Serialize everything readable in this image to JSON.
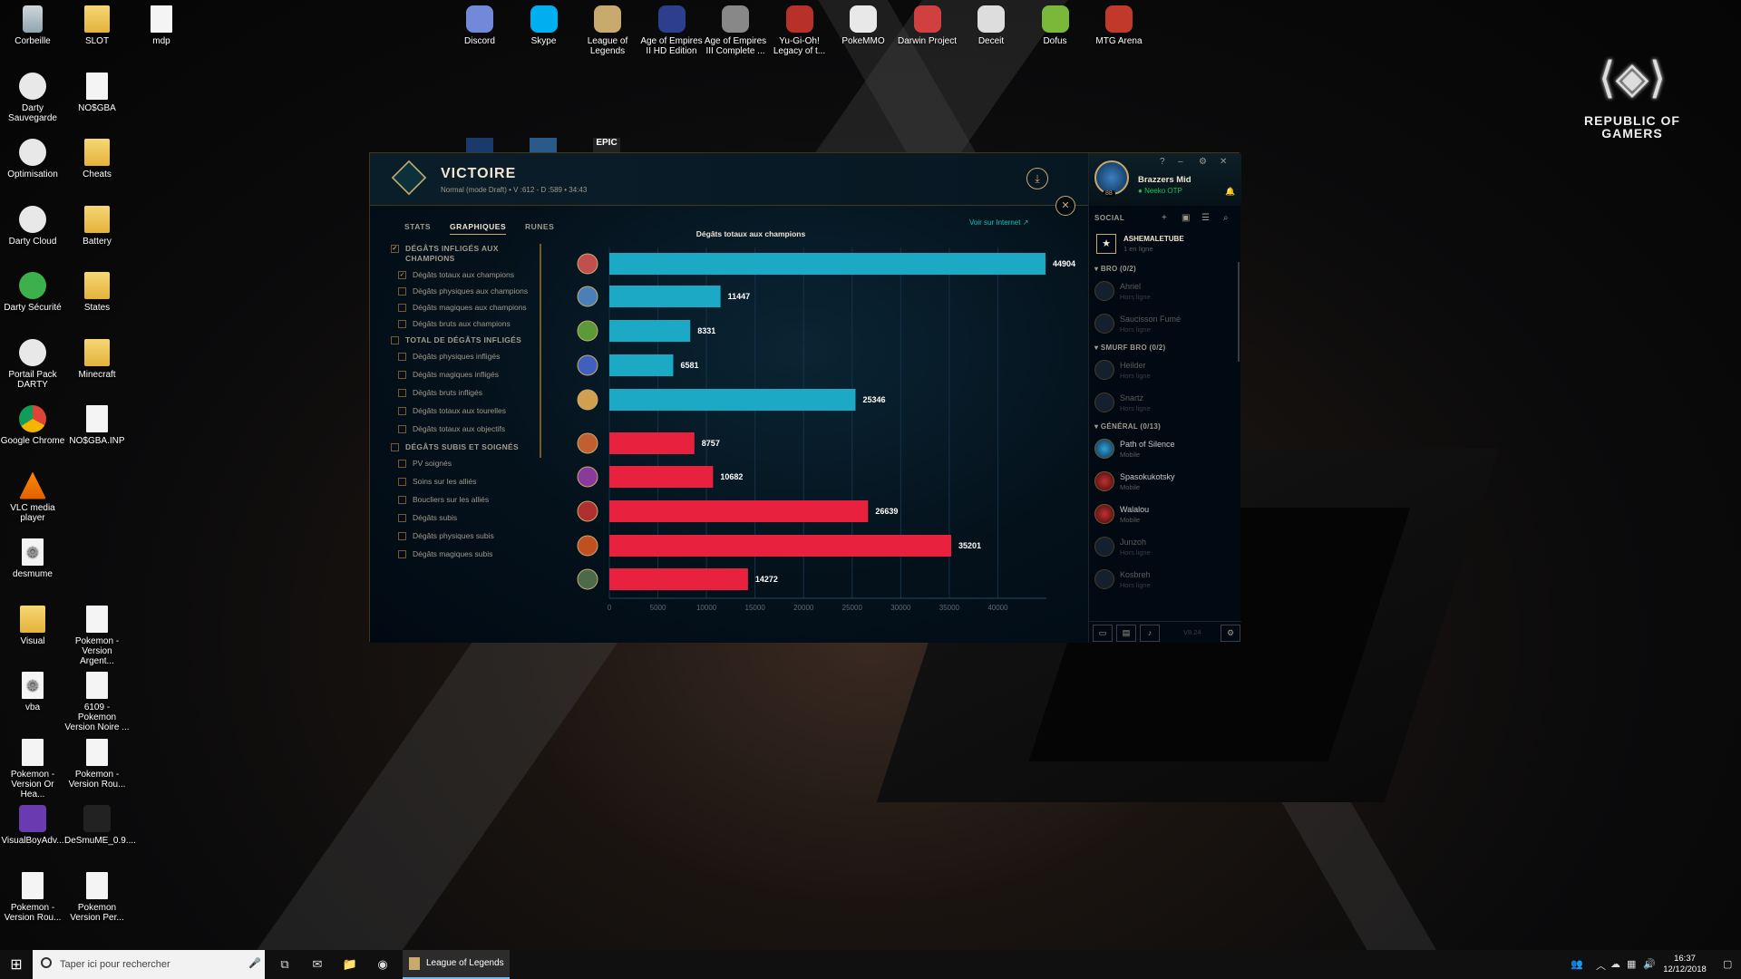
{
  "desktop": {
    "left_icons": [
      {
        "label": "Corbeille",
        "icon": "recycle-bin-icon"
      },
      {
        "label": "SLOT",
        "icon": "folder-icon"
      },
      {
        "label": "mdp",
        "icon": "file-icon"
      },
      {
        "label": "Darty Sauvegarde",
        "icon": "darty-icon"
      },
      {
        "label": "NO$GBA",
        "icon": "file-icon"
      },
      {
        "label": "Optimisation",
        "icon": "darty-icon"
      },
      {
        "label": "Cheats",
        "icon": "folder-icon"
      },
      {
        "label": "Darty Cloud",
        "icon": "darty-icon"
      },
      {
        "label": "Battery",
        "icon": "folder-icon"
      },
      {
        "label": "Darty Sécurité",
        "icon": "shield-icon"
      },
      {
        "label": "States",
        "icon": "folder-icon"
      },
      {
        "label": "Portail Pack DARTY",
        "icon": "darty-icon"
      },
      {
        "label": "Minecraft",
        "icon": "folder-icon"
      },
      {
        "label": "Google Chrome",
        "icon": "chrome-icon"
      },
      {
        "label": "NO$GBA.INP",
        "icon": "file-icon"
      },
      {
        "label": "VLC media player",
        "icon": "vlc-icon"
      },
      {
        "label": "desmume",
        "icon": "gear-file-icon"
      },
      {
        "label": "Visual",
        "icon": "folder-icon"
      },
      {
        "label": "Pokemon - Version Argent...",
        "icon": "file-icon"
      },
      {
        "label": "vba",
        "icon": "gear-file-icon"
      },
      {
        "label": "6109 - Pokemon Version Noire ...",
        "icon": "file-icon"
      },
      {
        "label": "Pokemon - Version Or Hea...",
        "icon": "file-icon"
      },
      {
        "label": "Pokemon - Version Rou...",
        "icon": "file-icon"
      },
      {
        "label": "VisualBoyAdv...",
        "icon": "vba-icon"
      },
      {
        "label": "DeSmuME_0.9....",
        "icon": "desmume-icon"
      },
      {
        "label": "Pokemon - Version Rou...",
        "icon": "file-icon"
      },
      {
        "label": "Pokemon Version Per...",
        "icon": "file-icon"
      }
    ],
    "top_icons": [
      {
        "label": "Discord",
        "icon": "discord-icon",
        "color": "#7289da"
      },
      {
        "label": "Skype",
        "icon": "skype-icon",
        "color": "#00aff0"
      },
      {
        "label": "League of Legends",
        "icon": "lol-icon",
        "color": "#c8aa6e"
      },
      {
        "label": "Age of Empires II HD Edition",
        "icon": "aoe2-icon",
        "color": "#2c3e8c"
      },
      {
        "label": "Age of Empires III Complete ...",
        "icon": "aoe3-icon",
        "color": "#888888"
      },
      {
        "label": "Yu-Gi-Oh! Legacy of t...",
        "icon": "yugioh-icon",
        "color": "#b8302a"
      },
      {
        "label": "PokeMMO",
        "icon": "pokeball-icon",
        "color": "#e8e8e8"
      },
      {
        "label": "Darwin Project",
        "icon": "darwin-icon",
        "color": "#d04040"
      },
      {
        "label": "Deceit",
        "icon": "deceit-icon",
        "color": "#dddddd"
      },
      {
        "label": "Dofus",
        "icon": "dofus-icon",
        "color": "#7ab83a"
      },
      {
        "label": "MTG Arena",
        "icon": "mtg-icon",
        "color": "#c0392b"
      }
    ],
    "hidden_icons": [
      "EPIC"
    ],
    "rog_text": "REPUBLIC OF GAMERS"
  },
  "client": {
    "title": "VICTOIRE",
    "mode": "Normal (mode Draft)",
    "kills": "V :612 - D :589",
    "duration": "34:43",
    "tabs": [
      "STATS",
      "GRAPHIQUES",
      "RUNES"
    ],
    "active_tab": "GRAPHIQUES",
    "view_online": "Voir sur Internet",
    "filters": [
      {
        "label": "DÉGÂTS INFLIGÉS AUX CHAMPIONS",
        "type": "cat",
        "checked": true
      },
      {
        "label": "Dégâts totaux aux champions",
        "type": "sub",
        "checked": true
      },
      {
        "label": "Dégâts physiques aux champions",
        "type": "sub",
        "checked": false
      },
      {
        "label": "Dégâts magiques aux champions",
        "type": "sub",
        "checked": false
      },
      {
        "label": "Dégâts bruts aux champions",
        "type": "sub",
        "checked": false
      },
      {
        "label": "TOTAL DE DÉGÂTS INFLIGÉS",
        "type": "cat",
        "checked": false
      },
      {
        "label": "Dégâts physiques infligés",
        "type": "sub",
        "checked": false
      },
      {
        "label": "Dégâts magiques infligés",
        "type": "sub",
        "checked": false
      },
      {
        "label": "Dégâts bruts infligés",
        "type": "sub",
        "checked": false
      },
      {
        "label": "Dégâts totaux aux tourelles",
        "type": "sub",
        "checked": false
      },
      {
        "label": "Dégâts totaux aux objectifs",
        "type": "sub",
        "checked": false
      },
      {
        "label": "DÉGÂTS SUBIS ET SOIGNÉS",
        "type": "cat",
        "checked": false
      },
      {
        "label": "PV soignés",
        "type": "sub",
        "checked": false
      },
      {
        "label": "Soins sur les alliés",
        "type": "sub",
        "checked": false
      },
      {
        "label": "Boucliers sur les alliés",
        "type": "sub",
        "checked": false
      },
      {
        "label": "Dégâts subis",
        "type": "sub",
        "checked": false
      },
      {
        "label": "Dégâts physiques subis",
        "type": "sub",
        "checked": false
      },
      {
        "label": "Dégâts magiques subis",
        "type": "sub",
        "checked": false
      }
    ]
  },
  "chart_data": {
    "type": "bar",
    "orientation": "horizontal",
    "title": "Dégâts totaux aux champions",
    "values": [
      44904,
      11447,
      8331,
      6581,
      25346,
      8757,
      10682,
      26639,
      35201,
      14272
    ],
    "value_labels": [
      "44904",
      "11447",
      "8331",
      "6581",
      "25346",
      "8757",
      "10682",
      "26639",
      "35201",
      "14272"
    ],
    "team_colors": [
      "#1ba9c5",
      "#1ba9c5",
      "#1ba9c5",
      "#1ba9c5",
      "#1ba9c5",
      "#e8223e",
      "#e8223e",
      "#e8223e",
      "#e8223e",
      "#e8223e"
    ],
    "portrait_colors": [
      "#c0504d",
      "#4a7fb8",
      "#5a9a3a",
      "#4060c0",
      "#d0a050",
      "#c06030",
      "#8a3a9a",
      "#b03030",
      "#c05020",
      "#4a6a4a"
    ],
    "x_ticks": [
      0,
      5000,
      10000,
      15000,
      20000,
      25000,
      30000,
      35000,
      40000
    ],
    "x_tick_labels": [
      "0",
      "5000",
      "10000",
      "15000",
      "20000",
      "25000",
      "30000",
      "35000",
      "40000"
    ],
    "xlim": [
      0,
      45000
    ],
    "grid": true
  },
  "social": {
    "username": "Brazzers Mid",
    "status": "Neeko OTP",
    "level": "88",
    "controls": [
      "?",
      "–",
      "⚙",
      "✕"
    ],
    "label": "SOCIAL",
    "club": {
      "name": "ASHEMALETUBE",
      "sub": "1 en ligne"
    },
    "groups": [
      {
        "title": "BRO (0/2)",
        "friends": [
          {
            "name": "Ahriel",
            "status": "Hors ligne",
            "state": "off"
          },
          {
            "name": "Saucisson Fumé",
            "status": "Hors ligne",
            "state": "off"
          }
        ]
      },
      {
        "title": "SMURF BRO (0/2)",
        "friends": [
          {
            "name": "Heilder",
            "status": "Hors ligne",
            "state": "off"
          },
          {
            "name": "Snartz",
            "status": "Hors ligne",
            "state": "off"
          }
        ]
      },
      {
        "title": "GÉNÉRAL (0/13)",
        "friends": [
          {
            "name": "Path of Silence",
            "status": "Mobile",
            "state": "mob b1"
          },
          {
            "name": "Spasokukotsky",
            "status": "Mobile",
            "state": "mob"
          },
          {
            "name": "Walalou",
            "status": "Mobile",
            "state": "mob"
          },
          {
            "name": "Junzoh",
            "status": "Hors ligne",
            "state": "off"
          },
          {
            "name": "Kosbreh",
            "status": "Hors ligne",
            "state": "off"
          }
        ]
      }
    ],
    "version": "V8.24"
  },
  "taskbar": {
    "search_placeholder": "Taper ici pour rechercher",
    "active_app": "League of Legends",
    "time": "16:37",
    "date": "12/12/2018"
  }
}
